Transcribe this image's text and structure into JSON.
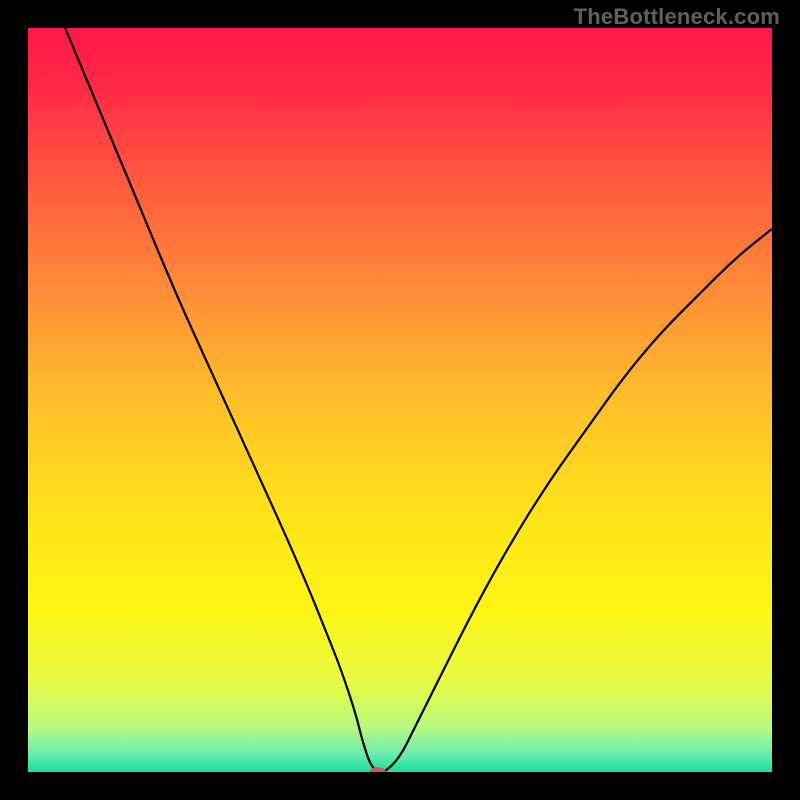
{
  "watermark": "TheBottleneck.com",
  "chart_data": {
    "type": "line",
    "title": "",
    "xlabel": "",
    "ylabel": "",
    "xlim": [
      0,
      100
    ],
    "ylim": [
      0,
      100
    ],
    "grid": false,
    "legend": false,
    "background": {
      "type": "vertical-gradient",
      "stops": [
        {
          "offset": 0.0,
          "color": "#ff1846"
        },
        {
          "offset": 0.08,
          "color": "#ff2a45"
        },
        {
          "offset": 0.2,
          "color": "#ff5740"
        },
        {
          "offset": 0.35,
          "color": "#ff8b38"
        },
        {
          "offset": 0.5,
          "color": "#ffbf2b"
        },
        {
          "offset": 0.65,
          "color": "#ffe21a"
        },
        {
          "offset": 0.78,
          "color": "#fdf514"
        },
        {
          "offset": 0.88,
          "color": "#e8fb45"
        },
        {
          "offset": 0.94,
          "color": "#b7f97f"
        },
        {
          "offset": 0.975,
          "color": "#6dedb0"
        },
        {
          "offset": 1.0,
          "color": "#18df9a"
        }
      ]
    },
    "series": [
      {
        "name": "bottleneck-curve",
        "stroke": "#000000",
        "stroke_width": 2.2,
        "x": [
          5,
          10,
          15,
          20,
          25,
          30,
          35,
          38,
          40,
          42,
          44,
          45,
          46,
          47,
          48,
          50,
          52,
          55,
          60,
          65,
          70,
          75,
          80,
          85,
          90,
          95,
          100
        ],
        "values": [
          100,
          88,
          76,
          64,
          53,
          42,
          31,
          24,
          19,
          14,
          8,
          4,
          1,
          0,
          0,
          2,
          6,
          12,
          22,
          31,
          39,
          46,
          53,
          59,
          64,
          69,
          73
        ]
      }
    ],
    "marker": {
      "name": "optimal-point",
      "x": 47,
      "y": 0,
      "color": "#c75a58",
      "rx": 8,
      "ry": 5
    }
  }
}
